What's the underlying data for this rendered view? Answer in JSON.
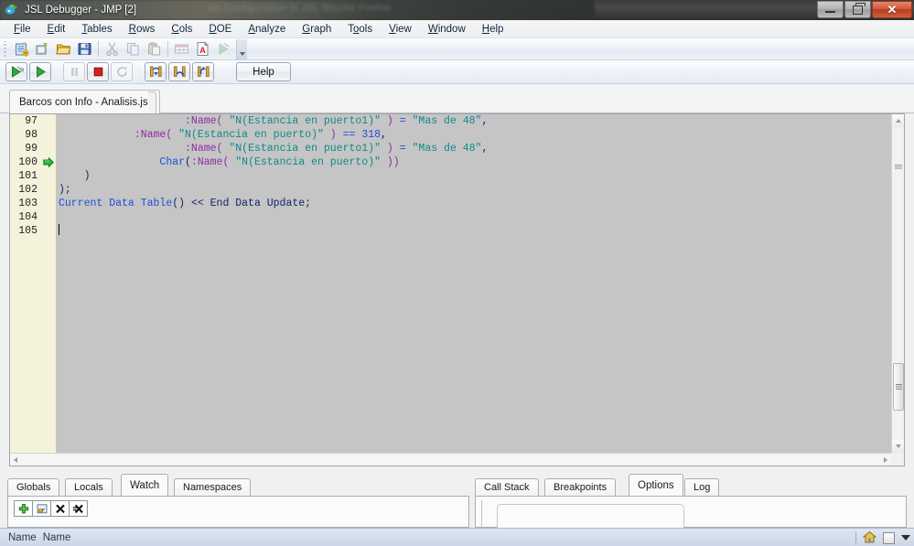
{
  "window": {
    "title": "JSL Debugger - JMP [2]",
    "ghost_title": "an Configuration in JSL  Mozilla Firefox",
    "app_icon": "jmp-icon",
    "buttons": {
      "minimize": "minimize-button",
      "restore": "restore-button",
      "close_label": "✕"
    }
  },
  "menubar": {
    "items": [
      {
        "label": "File",
        "accel": "F"
      },
      {
        "label": "Edit",
        "accel": "E"
      },
      {
        "label": "Tables",
        "accel": "T"
      },
      {
        "label": "Rows",
        "accel": "R"
      },
      {
        "label": "Cols",
        "accel": "C"
      },
      {
        "label": "DOE",
        "accel": "D"
      },
      {
        "label": "Analyze",
        "accel": "A"
      },
      {
        "label": "Graph",
        "accel": "G"
      },
      {
        "label": "Tools",
        "accel": "o"
      },
      {
        "label": "View",
        "accel": "V"
      },
      {
        "label": "Window",
        "accel": "W"
      },
      {
        "label": "Help",
        "accel": "H"
      }
    ]
  },
  "toolbar_main": {
    "buttons": [
      {
        "icon": "new-script-icon",
        "label": "New Script",
        "enabled": true
      },
      {
        "icon": "new-journal-icon",
        "label": "New Journal",
        "enabled": true
      },
      {
        "icon": "open-folder-icon",
        "label": "Open",
        "enabled": true
      },
      {
        "icon": "save-icon",
        "label": "Save",
        "enabled": true
      },
      {
        "icon": "cut-icon",
        "label": "Cut",
        "enabled": false
      },
      {
        "icon": "copy-icon",
        "label": "Copy",
        "enabled": false
      },
      {
        "icon": "paste-icon",
        "label": "Paste",
        "enabled": false
      },
      {
        "icon": "data-table-icon",
        "label": "Data Table",
        "enabled": false
      },
      {
        "icon": "script-doc-icon",
        "label": "Script",
        "enabled": true
      },
      {
        "icon": "run-script-icon",
        "label": "Run Script",
        "enabled": false
      }
    ],
    "overflow": "toolbar-overflow-chevron"
  },
  "toolbar_debug": {
    "buttons": [
      {
        "icon": "debug-run-icon",
        "label": "Run with Debugger",
        "enabled": true
      },
      {
        "icon": "run-icon",
        "label": "Run",
        "enabled": true
      },
      {
        "icon": "pause-icon",
        "label": "Pause",
        "enabled": false
      },
      {
        "icon": "stop-icon",
        "label": "Stop",
        "enabled": true
      },
      {
        "icon": "restart-icon",
        "label": "Restart",
        "enabled": false
      },
      {
        "icon": "step-into-icon",
        "label": "Step Into",
        "enabled": true
      },
      {
        "icon": "step-over-icon",
        "label": "Step Over",
        "enabled": true
      },
      {
        "icon": "step-out-icon",
        "label": "Step Out",
        "enabled": true
      }
    ],
    "help_label": "Help"
  },
  "document_tabs": {
    "tabs": [
      {
        "label": "Barcos con Info - Analisis.jsl",
        "active": true
      }
    ]
  },
  "editor": {
    "first_line": 97,
    "current_execution_line": 100,
    "caret_line": 105,
    "lines": [
      {
        "n": 97,
        "tokens": [
          {
            "t": "                    ",
            "c": "plain"
          },
          {
            "t": ":Name(",
            "c": "name"
          },
          {
            "t": " ",
            "c": "plain"
          },
          {
            "t": "\"N(Estancia en puerto1)\"",
            "c": "str"
          },
          {
            "t": " ",
            "c": "plain"
          },
          {
            "t": ")",
            "c": "name"
          },
          {
            "t": " ",
            "c": "plain"
          },
          {
            "t": "=",
            "c": "num"
          },
          {
            "t": " ",
            "c": "plain"
          },
          {
            "t": "\"Mas de 48\"",
            "c": "str"
          },
          {
            "t": ",",
            "c": "plain"
          }
        ]
      },
      {
        "n": 98,
        "tokens": [
          {
            "t": "            ",
            "c": "plain"
          },
          {
            "t": ":Name(",
            "c": "name"
          },
          {
            "t": " ",
            "c": "plain"
          },
          {
            "t": "\"N(Estancia en puerto)\"",
            "c": "str"
          },
          {
            "t": " ",
            "c": "plain"
          },
          {
            "t": ")",
            "c": "name"
          },
          {
            "t": " ",
            "c": "plain"
          },
          {
            "t": "==",
            "c": "num"
          },
          {
            "t": " ",
            "c": "plain"
          },
          {
            "t": "318",
            "c": "num"
          },
          {
            "t": ",",
            "c": "plain"
          }
        ]
      },
      {
        "n": 99,
        "tokens": [
          {
            "t": "                    ",
            "c": "plain"
          },
          {
            "t": ":Name(",
            "c": "name"
          },
          {
            "t": " ",
            "c": "plain"
          },
          {
            "t": "\"N(Estancia en puerto1)\"",
            "c": "str"
          },
          {
            "t": " ",
            "c": "plain"
          },
          {
            "t": ")",
            "c": "name"
          },
          {
            "t": " ",
            "c": "plain"
          },
          {
            "t": "=",
            "c": "num"
          },
          {
            "t": " ",
            "c": "plain"
          },
          {
            "t": "\"Mas de 48\"",
            "c": "str"
          },
          {
            "t": ",",
            "c": "plain"
          }
        ]
      },
      {
        "n": 100,
        "tokens": [
          {
            "t": "                ",
            "c": "plain"
          },
          {
            "t": "Char",
            "c": "fn"
          },
          {
            "t": "(",
            "c": "plain"
          },
          {
            "t": ":Name(",
            "c": "name"
          },
          {
            "t": " ",
            "c": "plain"
          },
          {
            "t": "\"N(Estancia en puerto)\"",
            "c": "str"
          },
          {
            "t": " ",
            "c": "plain"
          },
          {
            "t": "))",
            "c": "name"
          }
        ]
      },
      {
        "n": 101,
        "tokens": [
          {
            "t": "    )",
            "c": "plain"
          }
        ]
      },
      {
        "n": 102,
        "tokens": [
          {
            "t": ");",
            "c": "plain"
          }
        ]
      },
      {
        "n": 103,
        "tokens": [
          {
            "t": "Current Data Table",
            "c": "fn"
          },
          {
            "t": "() << End Data Update;",
            "c": "plain"
          }
        ]
      },
      {
        "n": 104,
        "tokens": [
          {
            "t": "",
            "c": "plain"
          }
        ]
      },
      {
        "n": 105,
        "tokens": [
          {
            "t": "",
            "c": "plain"
          }
        ]
      }
    ],
    "scrollbars": {
      "vertical": "editor-vertical-scrollbar",
      "horizontal": "editor-horizontal-scrollbar"
    }
  },
  "left_panel": {
    "tabs": [
      {
        "label": "Globals",
        "active": false
      },
      {
        "label": "Locals",
        "active": false
      },
      {
        "label": "Watch",
        "active": true
      },
      {
        "label": "Namespaces",
        "active": false
      }
    ],
    "toolbar": [
      {
        "icon": "add-watch-icon",
        "label": "Add"
      },
      {
        "icon": "edit-watch-icon",
        "label": "Edit"
      },
      {
        "icon": "delete-watch-icon",
        "label": "Delete"
      },
      {
        "icon": "delete-all-watch-icon",
        "label": "Delete All"
      }
    ],
    "columns": [
      "Name",
      "Name"
    ]
  },
  "right_panel": {
    "tabs": [
      {
        "label": "Call Stack",
        "active": false
      },
      {
        "label": "Breakpoints",
        "active": false
      },
      {
        "label": "Options",
        "active": true
      },
      {
        "label": "Log",
        "active": false
      }
    ]
  },
  "statusbar": {
    "text": "",
    "icons": [
      {
        "icon": "home-icon",
        "label": "Home"
      },
      {
        "icon": "window-square-icon",
        "label": "Window"
      },
      {
        "icon": "dropdown-arrow-icon",
        "label": "More"
      }
    ]
  },
  "colors": {
    "accent_close": "#b83a1d",
    "gutter_bg": "#f5f2dc",
    "code_bg": "#c5c5c5",
    "string": "#108a8a",
    "keyword": "#1f4fd8",
    "name": "#8a2fa0",
    "plain": "#14246b",
    "exec_arrow": "#21a83a",
    "statusbar": "#ccd7e7"
  }
}
